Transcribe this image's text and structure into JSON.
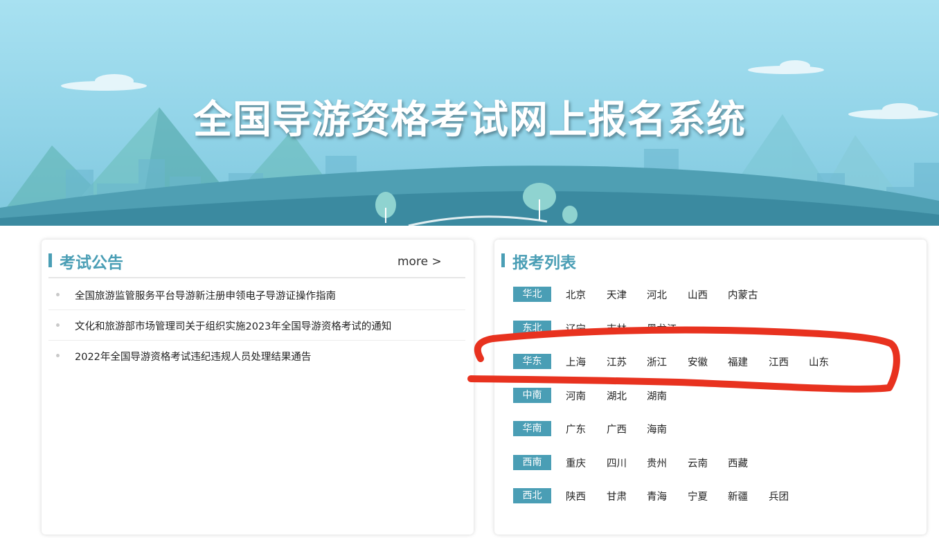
{
  "banner": {
    "title": "全国导游资格考试网上报名系统"
  },
  "notices": {
    "title": "考试公告",
    "more": "more >",
    "items": [
      "全国旅游监管服务平台导游新注册申领电子导游证操作指南",
      "文化和旅游部市场管理司关于组织实施2023年全国导游资格考试的通知",
      "2022年全国导游资格考试违纪违规人员处理结果通告"
    ]
  },
  "regions": {
    "title": "报考列表",
    "rows": [
      {
        "region": "华北",
        "provinces": [
          "北京",
          "天津",
          "河北",
          "山西",
          "内蒙古"
        ]
      },
      {
        "region": "东北",
        "provinces": [
          "辽宁",
          "吉林",
          "黑龙江"
        ]
      },
      {
        "region": "华东",
        "provinces": [
          "上海",
          "江苏",
          "浙江",
          "安徽",
          "福建",
          "江西",
          "山东"
        ]
      },
      {
        "region": "中南",
        "provinces": [
          "河南",
          "湖北",
          "湖南"
        ]
      },
      {
        "region": "华南",
        "provinces": [
          "广东",
          "广西",
          "海南"
        ]
      },
      {
        "region": "西南",
        "provinces": [
          "重庆",
          "四川",
          "贵州",
          "云南",
          "西藏"
        ]
      },
      {
        "region": "西北",
        "provinces": [
          "陕西",
          "甘肃",
          "青海",
          "宁夏",
          "新疆",
          "兵团"
        ]
      }
    ]
  },
  "colors": {
    "accent": "#4a9eb5",
    "annotation": "#e8321f"
  }
}
